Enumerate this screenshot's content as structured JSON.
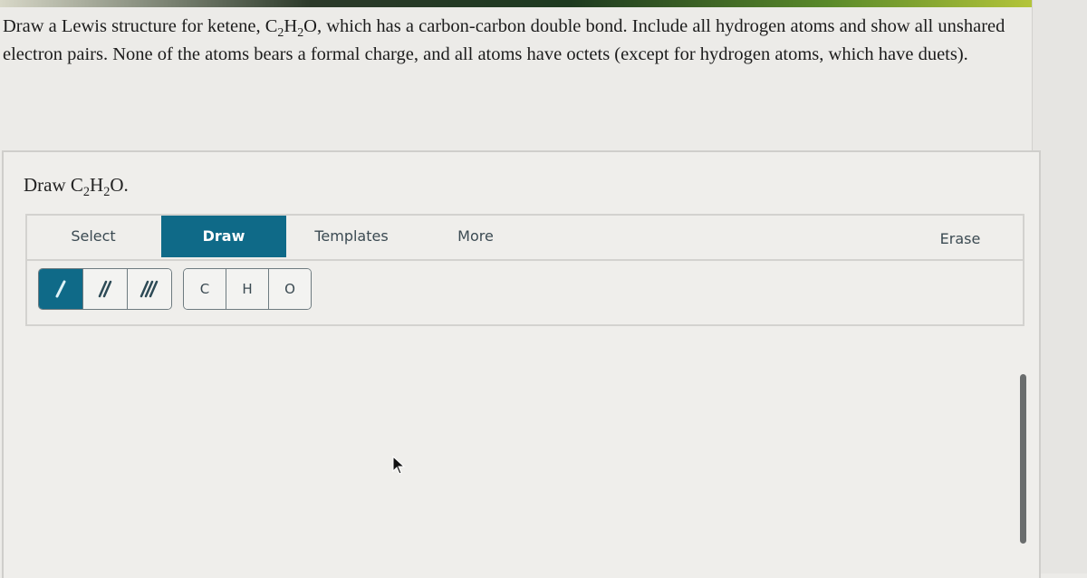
{
  "question": {
    "part1": "Draw a Lewis structure for ketene, C",
    "sub1": "2",
    "part2": "H",
    "sub2": "2",
    "part3": "O, which has a carbon-carbon double bond. Include all hydrogen atoms and show all unshared electron pairs. None of the atoms bears a formal charge, and all atoms have octets (except for hydrogen atoms, which have duets)."
  },
  "prompt": {
    "prefix": "Draw C",
    "sub1": "2",
    "mid": "H",
    "sub2": "2",
    "suffix": "O."
  },
  "tabs": [
    {
      "label": "Select",
      "active": false
    },
    {
      "label": "Draw",
      "active": true
    },
    {
      "label": "Templates",
      "active": false
    },
    {
      "label": "More",
      "active": false
    },
    {
      "label": "Erase",
      "active": false
    }
  ],
  "bond_tools": [
    {
      "name": "single-bond",
      "active": true
    },
    {
      "name": "double-bond",
      "active": false
    },
    {
      "name": "triple-bond",
      "active": false
    }
  ],
  "atom_tools": [
    {
      "label": "C"
    },
    {
      "label": "H"
    },
    {
      "label": "O"
    }
  ],
  "colors": {
    "accent": "#0f6a88",
    "tab_text": "#3b4a52"
  }
}
